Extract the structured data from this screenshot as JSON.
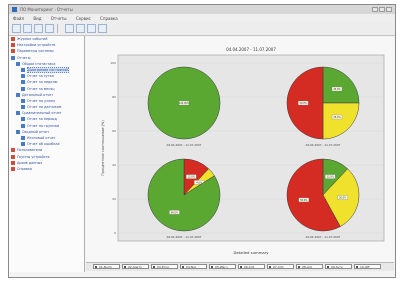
{
  "window": {
    "title": "ПО Мониторинг · Отчеты",
    "buttons": [
      "min",
      "max",
      "close"
    ]
  },
  "menubar": [
    "Файл",
    "Вид",
    "Отчеты",
    "Сервис",
    "Справка"
  ],
  "toolbar": {
    "icons": [
      "new-icon",
      "open-icon",
      "save-icon",
      "print-icon",
      "refresh-icon",
      "filter-icon",
      "chart-icon",
      "help-icon"
    ]
  },
  "sidebar": {
    "items": [
      {
        "label": "Журнал событий",
        "icon": "red",
        "indent": 0
      },
      {
        "label": "Настройки устройств",
        "icon": "red",
        "indent": 0
      },
      {
        "label": "Параметры системы",
        "icon": "red",
        "indent": 0
      },
      {
        "label": "Отчеты",
        "icon": "blue",
        "indent": 0
      },
      {
        "label": "Общая статистика",
        "icon": "blue",
        "indent": 1
      },
      {
        "label": "Диаграмма состояний",
        "icon": "blue",
        "indent": 2,
        "selected": true
      },
      {
        "label": "Отчет за сутки",
        "icon": "blue",
        "indent": 2
      },
      {
        "label": "Отчет за неделю",
        "icon": "blue",
        "indent": 2
      },
      {
        "label": "Отчет за месяц",
        "icon": "blue",
        "indent": 2
      },
      {
        "label": "Детальный отчет",
        "icon": "blue",
        "indent": 1
      },
      {
        "label": "Отчет по узлам",
        "icon": "blue",
        "indent": 2
      },
      {
        "label": "Отчет по датчикам",
        "icon": "blue",
        "indent": 2
      },
      {
        "label": "Сравнительный отчет",
        "icon": "blue",
        "indent": 1
      },
      {
        "label": "Отчет за период",
        "icon": "blue",
        "indent": 2
      },
      {
        "label": "Отчет по группам",
        "icon": "blue",
        "indent": 2
      },
      {
        "label": "Сводный отчет",
        "icon": "blue",
        "indent": 1
      },
      {
        "label": "Итоговый отчет",
        "icon": "blue",
        "indent": 2
      },
      {
        "label": "Отчет об ошибках",
        "icon": "blue",
        "indent": 2
      },
      {
        "label": "Пользователи",
        "icon": "red",
        "indent": 0
      },
      {
        "label": "Группы устройств",
        "icon": "red",
        "indent": 0
      },
      {
        "label": "Архив данных",
        "icon": "red",
        "indent": 0
      },
      {
        "label": "Справка",
        "icon": "red",
        "indent": 0
      }
    ]
  },
  "colors": {
    "ok": "#5aa832",
    "warning": "#f0e22c",
    "critical": "#d42b23",
    "plot_bg": "#e6e6e6"
  },
  "chart_data": {
    "type": "pie",
    "title": "04.04.2007 - 11.07.2007",
    "ylabel": "Процентное соотношение (%)",
    "xlabel": "Detailed summary",
    "grid": true,
    "legend_position": "bottom",
    "yticks": [
      "100",
      "80",
      "60",
      "40",
      "20",
      "0"
    ],
    "pies": [
      {
        "label": "04.04.2007 - 11.07.2007",
        "slices": [
          {
            "name": "ok",
            "value": 100,
            "label": "100.00%"
          }
        ]
      },
      {
        "label": "04.04.2007 - 11.07.2007",
        "slices": [
          {
            "name": "ok",
            "value": 25,
            "label": "25.0%"
          },
          {
            "name": "warning",
            "value": 25,
            "label": "25.0%"
          },
          {
            "name": "critical",
            "value": 50,
            "label": "50.0%"
          }
        ]
      },
      {
        "label": "04.04.2007 - 11.07.2007",
        "slices": [
          {
            "name": "critical",
            "value": 12,
            "label": "12.0%"
          },
          {
            "name": "warning",
            "value": 4,
            "label": "4.0%"
          },
          {
            "name": "ok",
            "value": 84,
            "label": "84.0%"
          }
        ]
      },
      {
        "label": "04.04.2007 - 11.07.2007",
        "slices": [
          {
            "name": "ok",
            "value": 12,
            "label": "12.0%"
          },
          {
            "name": "warning",
            "value": 30,
            "label": "30.0%"
          },
          {
            "name": "critical",
            "value": 58,
            "label": "58.0%"
          }
        ]
      }
    ]
  },
  "legend_items": [
    "01-Norm",
    "02-Alarm",
    "03-Error",
    "04-N/A",
    "05-Warn",
    "06-Crit",
    "07-Info",
    "08-Ack",
    "09-Sync",
    "10-Off"
  ]
}
